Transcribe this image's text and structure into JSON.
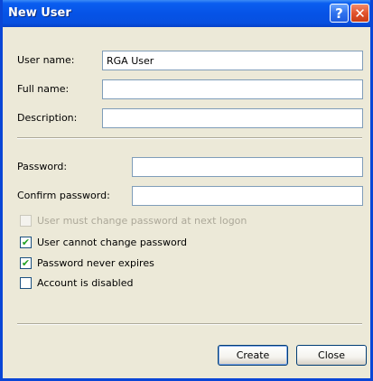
{
  "window": {
    "title": "New User",
    "help_glyph": "?",
    "close_glyph": "✕"
  },
  "form": {
    "username_label": "User name:",
    "username_value": "RGA User",
    "fullname_label": "Full name:",
    "fullname_value": "",
    "description_label": "Description:",
    "description_value": "",
    "password_label": "Password:",
    "password_value": "",
    "confirm_label": "Confirm password:",
    "confirm_value": ""
  },
  "options": [
    {
      "label": "User must change password at next logon",
      "checked": false,
      "disabled": true
    },
    {
      "label": "User cannot change password",
      "checked": true,
      "disabled": false
    },
    {
      "label": "Password never expires",
      "checked": true,
      "disabled": false
    },
    {
      "label": "Account is disabled",
      "checked": false,
      "disabled": false
    }
  ],
  "buttons": {
    "create": "Create",
    "close": "Close"
  },
  "check_glyph": "✔"
}
